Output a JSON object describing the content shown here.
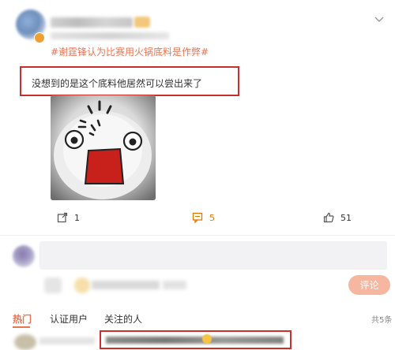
{
  "post": {
    "hashtag": "#谢霆锋认为比赛用火锅底料是作弊#",
    "text": "没想到的是这个底料他居然可以尝出来了"
  },
  "actions": {
    "share_count": "1",
    "comment_count": "5",
    "like_count": "51"
  },
  "comment_box": {
    "submit_label": "评论"
  },
  "tabs": {
    "hot": "热门",
    "verified": "认证用户",
    "following": "关注的人"
  },
  "total_count": "共5条",
  "colors": {
    "accent": "#eb7350",
    "highlight_border": "#c9302c",
    "comment_count": "#e07800",
    "submit_bg": "#f6b6a0"
  },
  "icons": [
    "chevron-down-icon",
    "share-icon",
    "comment-icon",
    "like-icon"
  ]
}
